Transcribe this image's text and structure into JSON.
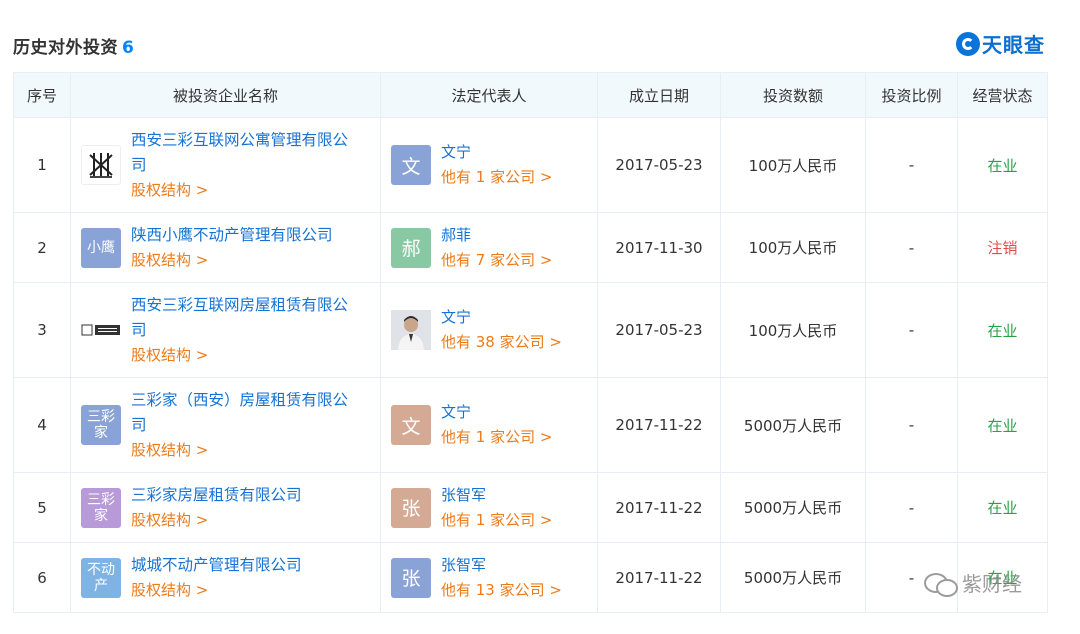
{
  "header": {
    "title": "历史对外投资",
    "count": "6",
    "brand": "天眼查"
  },
  "columns": [
    "序号",
    "被投资企业名称",
    "法定代表人",
    "成立日期",
    "投资数额",
    "投资比例",
    "经营状态"
  ],
  "rows": [
    {
      "index": "1",
      "company_lines": [
        "西安三彩互联网公寓管理有限公",
        "司"
      ],
      "company_logo": "",
      "equity_link": "股权结构 >",
      "rep_name": "文宁",
      "rep_avatar_text": "文",
      "rep_more": "他有 1 家公司 >",
      "date": "2017-05-23",
      "amount": "100万人民币",
      "ratio": "-",
      "status": "在业"
    },
    {
      "index": "2",
      "company_lines": [
        "陕西小鹰不动产管理有限公司"
      ],
      "company_logo": "小鹰",
      "equity_link": "股权结构 >",
      "rep_name": "郝菲",
      "rep_avatar_text": "郝",
      "rep_more": "他有 7 家公司 >",
      "date": "2017-11-30",
      "amount": "100万人民币",
      "ratio": "-",
      "status": "注销"
    },
    {
      "index": "3",
      "company_lines": [
        "西安三彩互联网房屋租赁有限公",
        "司"
      ],
      "company_logo": "",
      "equity_link": "股权结构 >",
      "rep_name": "文宁",
      "rep_avatar_text": "",
      "rep_more": "他有 38 家公司 >",
      "date": "2017-05-23",
      "amount": "100万人民币",
      "ratio": "-",
      "status": "在业"
    },
    {
      "index": "4",
      "company_lines": [
        "三彩家（西安）房屋租赁有限公",
        "司"
      ],
      "company_logo": "三彩家",
      "equity_link": "股权结构 >",
      "rep_name": "文宁",
      "rep_avatar_text": "文",
      "rep_more": "他有 1 家公司 >",
      "date": "2017-11-22",
      "amount": "5000万人民币",
      "ratio": "-",
      "status": "在业"
    },
    {
      "index": "5",
      "company_lines": [
        "三彩家房屋租赁有限公司"
      ],
      "company_logo": "三彩家",
      "equity_link": "股权结构 >",
      "rep_name": "张智军",
      "rep_avatar_text": "张",
      "rep_more": "他有 1 家公司 >",
      "date": "2017-11-22",
      "amount": "5000万人民币",
      "ratio": "-",
      "status": "在业"
    },
    {
      "index": "6",
      "company_lines": [
        "城城不动产管理有限公司"
      ],
      "company_logo": "不动产",
      "equity_link": "股权结构 >",
      "rep_name": "张智军",
      "rep_avatar_text": "张",
      "rep_more": "他有 13 家公司 >",
      "date": "2017-11-22",
      "amount": "5000万人民币",
      "ratio": "-",
      "status": "在业"
    }
  ],
  "watermark": "紫财经",
  "colors": {
    "link": "#1673d3",
    "orange": "#ee7b1a",
    "status_ok": "#2aa146",
    "status_bad": "#e64b4b",
    "header_bg": "#f2f9fc",
    "avatar_blue": "#8aa3d6",
    "avatar_green": "#88c9a3",
    "avatar_tan": "#d4aa94",
    "logo_blue": "#8aa3d6",
    "logo_purple": "#b89ad9",
    "logo_sky": "#7fb3e3"
  }
}
